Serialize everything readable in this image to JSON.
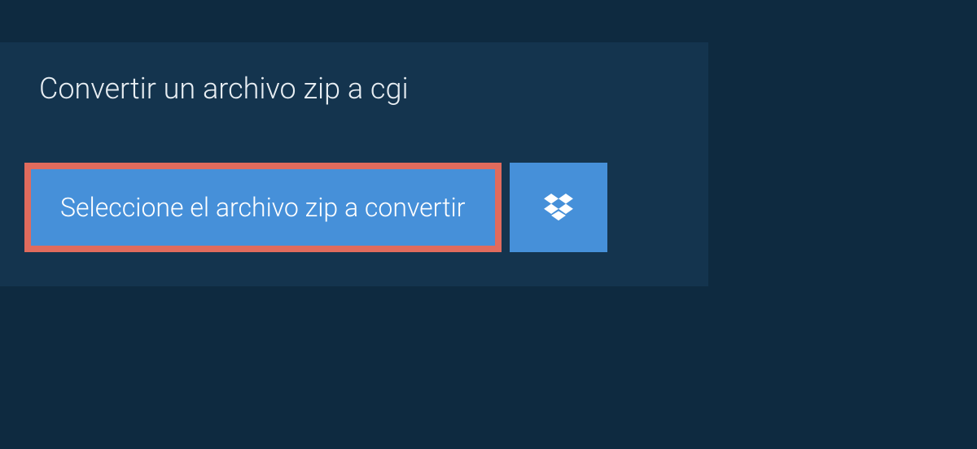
{
  "header": {
    "title": "Convertir un archivo zip a cgi"
  },
  "actions": {
    "select_label": "Seleccione el archivo zip a convertir"
  },
  "colors": {
    "page_bg": "#0e2a40",
    "panel_bg": "#14344e",
    "button_bg": "#4690d9",
    "highlight_border": "#e06b5d",
    "text_light": "#ffffff"
  }
}
